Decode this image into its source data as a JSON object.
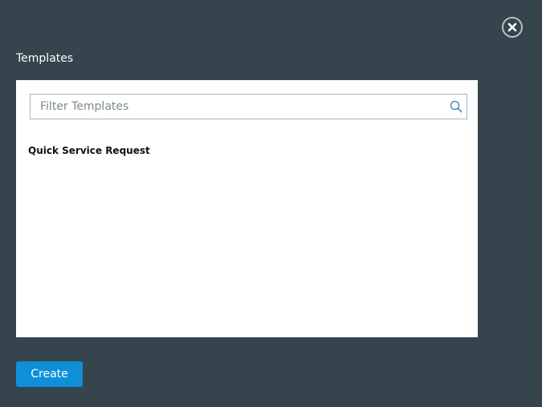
{
  "dialog": {
    "title": "Templates"
  },
  "filter": {
    "placeholder": "Filter Templates",
    "value": ""
  },
  "templates": [
    {
      "label": "Quick Service Request"
    }
  ],
  "actions": {
    "create_label": "Create"
  },
  "icons": {
    "close": "close-icon",
    "search": "search-icon"
  },
  "colors": {
    "background": "#36444d",
    "panel": "#ffffff",
    "accent": "#0f8fd8",
    "search_icon": "#4a8fc4"
  }
}
